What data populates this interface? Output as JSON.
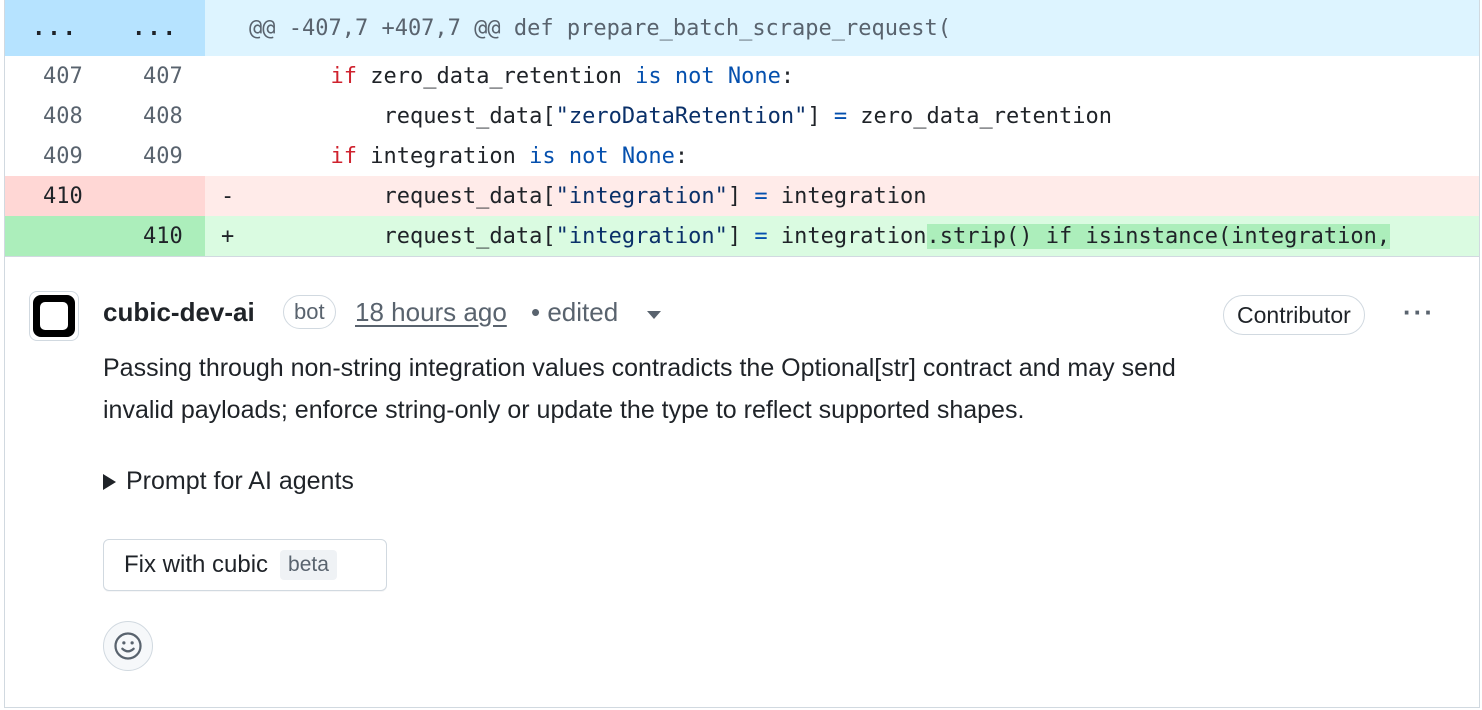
{
  "diff": {
    "hunk": {
      "left": "...",
      "right": "...",
      "text": "@@ -407,7 +407,7 @@ def prepare_batch_scrape_request("
    },
    "rows": [
      {
        "old": "407",
        "new": "407"
      },
      {
        "old": "408",
        "new": "408"
      },
      {
        "old": "409",
        "new": "409"
      },
      {
        "old": "410",
        "new": "",
        "marker": "-"
      },
      {
        "old": "",
        "new": "410",
        "marker": "+"
      }
    ],
    "line407": {
      "kw_if": "if",
      "a": " zero_data_retention ",
      "kw_is": "is",
      "sp": " ",
      "kw_not": "not",
      "sp2": " ",
      "kw_none": "None",
      "end": ":"
    },
    "line408": {
      "a": "request_data[",
      "q1": "\"",
      "s": "zeroDataRetention",
      "q2": "\"",
      "b": "] ",
      "eq": "=",
      "c": " zero_data_retention"
    },
    "line409": {
      "kw_if": "if",
      "a": " integration ",
      "kw_is": "is",
      "sp": " ",
      "kw_not": "not",
      "sp2": " ",
      "kw_none": "None",
      "end": ":"
    },
    "line410_del": {
      "a": "request_data[",
      "q1": "\"",
      "s": "integration",
      "q2": "\"",
      "b": "] ",
      "eq": "=",
      "c": " integration"
    },
    "line410_add": {
      "a": "request_data[",
      "q1": "\"",
      "s": "integration",
      "q2": "\"",
      "b": "] ",
      "eq": "=",
      "c": " integration",
      "hl": ".strip() if isinstance(integration,"
    }
  },
  "comment": {
    "author": "cubic-dev-ai",
    "bot_label": "bot",
    "time": "18 hours ago",
    "edited": "• edited",
    "role": "Contributor",
    "more": "···",
    "body_line1": "Passing through non-string integration values contradicts the Optional[str] contract and may send",
    "body_line2": "invalid payloads; enforce string-only or update the type to reflect supported shapes.",
    "details_label": "Prompt for AI agents",
    "fix_button": "Fix with cubic",
    "beta": "beta"
  },
  "icons": {
    "avatar": "cubic-logo-icon",
    "caret": "caret-down-icon",
    "triangle": "triangle-right-icon",
    "emoji": "smiley-icon"
  },
  "colors": {
    "hunk_bg": "#ddf4ff",
    "del_bg": "#ffebe9",
    "add_bg": "#dafbe1",
    "add_highlight": "#aceebb"
  }
}
